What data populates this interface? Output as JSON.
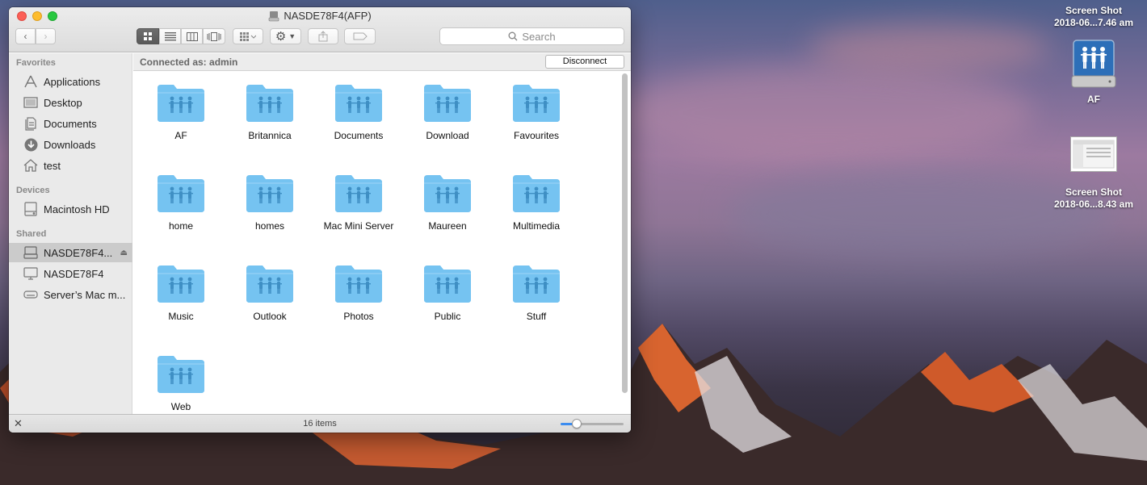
{
  "window": {
    "title": "NASDE78F4(AFP)",
    "connected_as": "Connected as: admin",
    "disconnect_label": "Disconnect",
    "search_placeholder": "Search",
    "status": "16 items",
    "icon_size_level": 0.25
  },
  "sidebar": {
    "sections": [
      {
        "heading": "Favorites",
        "items": [
          {
            "label": "Applications",
            "icon": "applications-icon"
          },
          {
            "label": "Desktop",
            "icon": "desktop-icon"
          },
          {
            "label": "Documents",
            "icon": "documents-icon"
          },
          {
            "label": "Downloads",
            "icon": "downloads-icon"
          },
          {
            "label": "test",
            "icon": "home-icon"
          }
        ]
      },
      {
        "heading": "Devices",
        "items": [
          {
            "label": "Macintosh HD",
            "icon": "hard-drive-icon"
          }
        ]
      },
      {
        "heading": "Shared",
        "items": [
          {
            "label": "NASDE78F4...",
            "icon": "nas-icon",
            "selected": true
          },
          {
            "label": "NASDE78F4",
            "icon": "monitor-icon"
          },
          {
            "label": "Server’s Mac m...",
            "icon": "mac-mini-icon"
          }
        ]
      }
    ]
  },
  "folders": [
    "AF",
    "Britannica",
    "Documents",
    "Download",
    "Favourites",
    "home",
    "homes",
    "Mac Mini Server",
    "Maureen",
    "Multimedia",
    "Music",
    "Outlook",
    "Photos",
    "Public",
    "Stuff",
    "Web"
  ],
  "desktop": {
    "items": [
      {
        "label_line1": "Screen Shot",
        "label_line2": "2018-06...7.46 am"
      },
      {
        "label_line1": "AF",
        "label_line2": ""
      },
      {
        "label_line1": "Screen Shot",
        "label_line2": "2018-06...8.43 am"
      }
    ]
  },
  "colors": {
    "folder": "#75c3f1",
    "selection": "#cbcbcb",
    "accent": "#3b8cf0"
  }
}
